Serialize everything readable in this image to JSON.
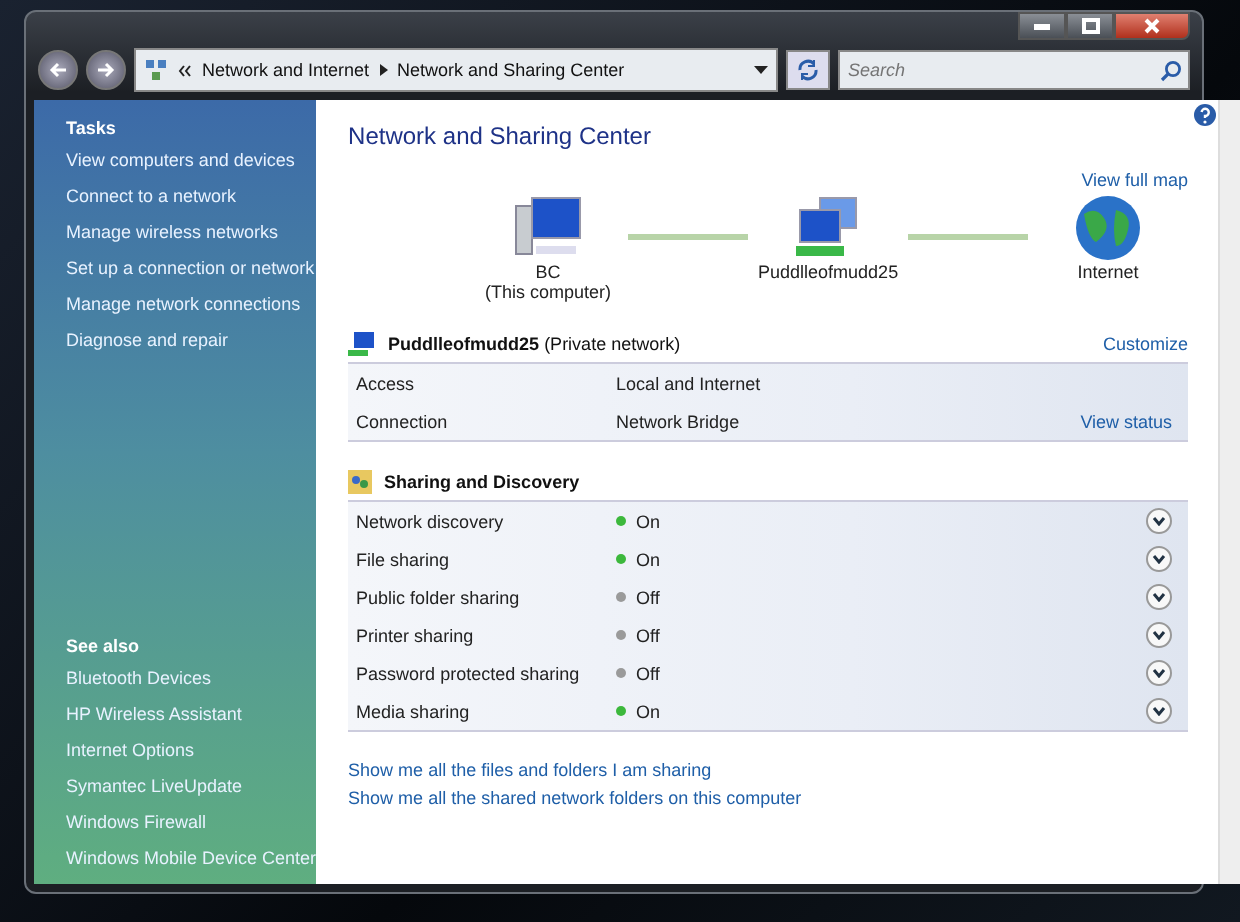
{
  "address_bar": {
    "crumbs": [
      "Network and Internet",
      "Network and Sharing Center"
    ],
    "placeholder": "Search"
  },
  "sidebar": {
    "tasks_heading": "Tasks",
    "tasks": [
      "View computers and devices",
      "Connect to a network",
      "Manage wireless networks",
      "Set up a connection or network",
      "Manage network connections",
      "Diagnose and repair"
    ],
    "see_also_heading": "See also",
    "see_also": [
      "Bluetooth Devices",
      "HP Wireless Assistant",
      "Internet Options",
      "Symantec LiveUpdate",
      "Windows Firewall",
      "Windows Mobile Device Center"
    ]
  },
  "main": {
    "title": "Network and Sharing Center",
    "full_map_link": "View full map",
    "map_nodes": [
      {
        "kind": "computer",
        "label": "BC",
        "sublabel": "(This computer)"
      },
      {
        "kind": "network",
        "label": "Puddlleofmudd25"
      },
      {
        "kind": "internet",
        "label": "Internet"
      }
    ],
    "network": {
      "name": "Puddlleofmudd25",
      "type": "(Private network)",
      "customize_link": "Customize",
      "rows": [
        {
          "label": "Access",
          "value": "Local and Internet"
        },
        {
          "label": "Connection",
          "value": "Network Bridge",
          "link": "View status"
        }
      ]
    },
    "sharing": {
      "heading": "Sharing and Discovery",
      "rows": [
        {
          "label": "Network discovery",
          "status": "On",
          "on": true,
          "expanded": false
        },
        {
          "label": "File sharing",
          "status": "On",
          "on": true,
          "expanded": false
        },
        {
          "label": "Public folder sharing",
          "status": "Off",
          "on": false,
          "expanded": false
        },
        {
          "label": "Printer sharing",
          "status": "Off",
          "on": false,
          "expanded": false
        },
        {
          "label": "Password protected sharing",
          "status": "Off",
          "on": false,
          "expanded": false
        },
        {
          "label": "Media sharing",
          "status": "On",
          "on": true,
          "expanded": false
        }
      ]
    },
    "links": [
      "Show me all the files and folders I am sharing",
      "Show me all the shared network folders on this computer"
    ]
  }
}
